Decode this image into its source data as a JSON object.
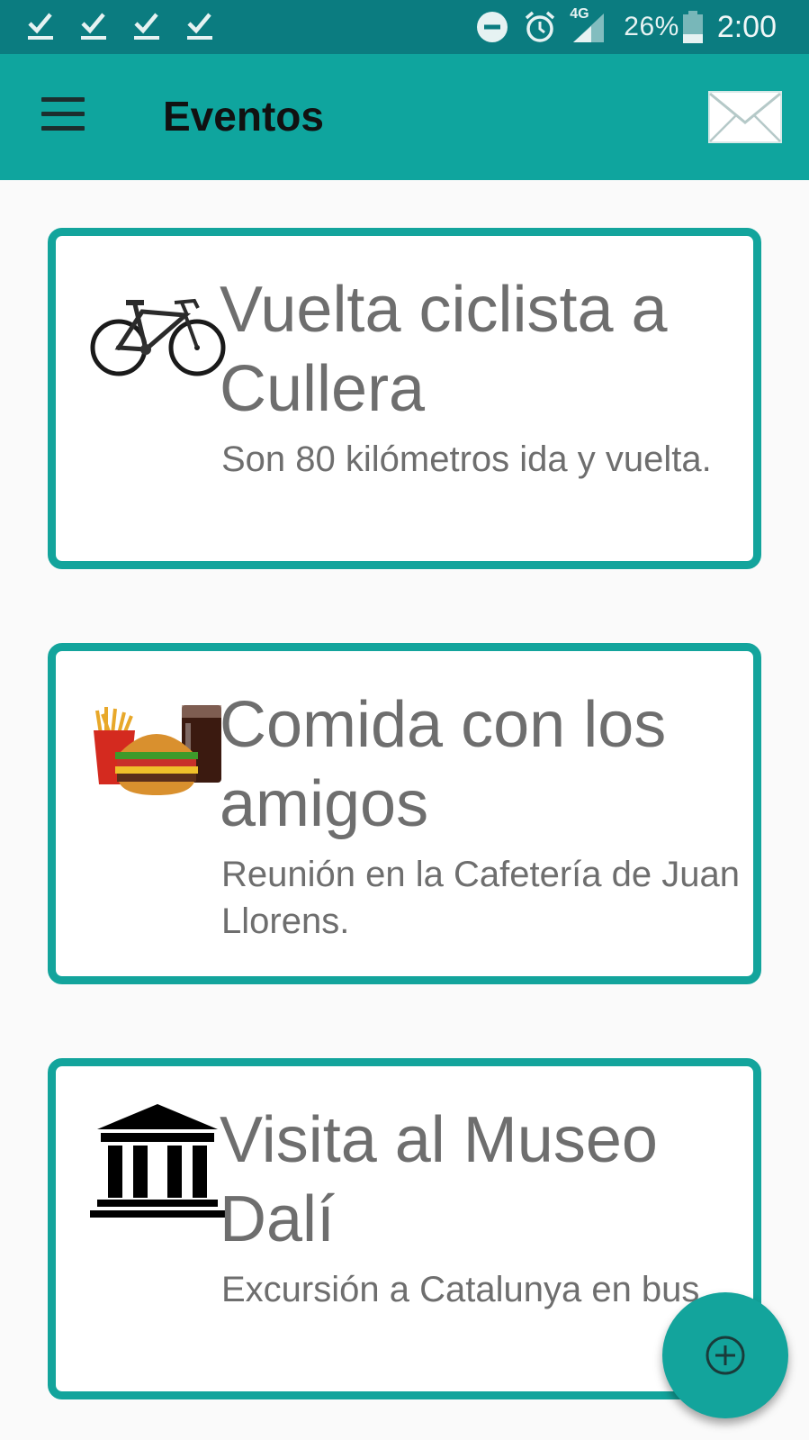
{
  "status_bar": {
    "battery_percent": "26%",
    "time": "2:00",
    "network": "4G",
    "icons": [
      "check-icon",
      "check-icon",
      "check-icon",
      "check-icon",
      "do-not-disturb-icon",
      "alarm-icon",
      "signal-icon",
      "battery-icon"
    ]
  },
  "app_bar": {
    "title": "Eventos",
    "menu_icon": "hamburger-menu-icon",
    "action_icon": "mail-icon"
  },
  "events": [
    {
      "title": "Vuelta ciclista a Cullera",
      "description": "Son 80 kilómetros ida y vuelta.",
      "image": "bicycle-image"
    },
    {
      "title": "Comida con los amigos",
      "description": "Reunión en la Cafetería de Juan Llorens.",
      "image": "burger-meal-image"
    },
    {
      "title": "Visita al Museo Dalí",
      "description": "Excursión a Catalunya en bus.",
      "image": "museum-image"
    }
  ],
  "fab": {
    "icon": "add-circle-icon"
  },
  "colors": {
    "status_bar": "#0b7c80",
    "app_bar": "#0fa59e",
    "card_border": "#13a49c",
    "text": "#6e6e6e",
    "background": "#fafafa"
  }
}
